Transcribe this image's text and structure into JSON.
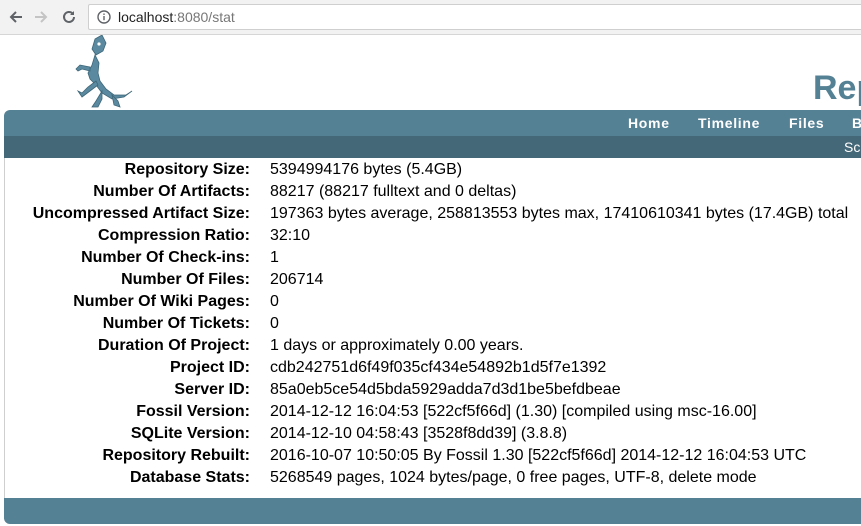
{
  "browser": {
    "url_host": "localhost",
    "url_rest": ":8080/stat"
  },
  "header": {
    "title": "Rep"
  },
  "mainmenu": {
    "items": [
      "Home",
      "Timeline",
      "Files",
      "B"
    ]
  },
  "submenu": {
    "items": [
      "Sc"
    ]
  },
  "stats": [
    {
      "label": "Repository Size:",
      "value": "5394994176 bytes (5.4GB)"
    },
    {
      "label": "Number Of Artifacts:",
      "value": "88217 (88217 fulltext and 0 deltas)"
    },
    {
      "label": "Uncompressed Artifact Size:",
      "value": "197363 bytes average, 258813553 bytes max, 17410610341 bytes (17.4GB) total"
    },
    {
      "label": "Compression Ratio:",
      "value": "32:10"
    },
    {
      "label": "Number Of Check-ins:",
      "value": "1"
    },
    {
      "label": "Number Of Files:",
      "value": "206714"
    },
    {
      "label": "Number Of Wiki Pages:",
      "value": "0"
    },
    {
      "label": "Number Of Tickets:",
      "value": "0"
    },
    {
      "label": "Duration Of Project:",
      "value": "1 days or approximately 0.00 years."
    },
    {
      "label": "Project ID:",
      "value": "cdb242751d6f49f035cf434e54892b1d5f7e1392"
    },
    {
      "label": "Server ID:",
      "value": "85a0eb5ce54d5bda5929adda7d3d1be5befdbeae"
    },
    {
      "label": "Fossil Version:",
      "value": "2014-12-12 16:04:53 [522cf5f66d] (1.30) [compiled using msc-16.00]"
    },
    {
      "label": "SQLite Version:",
      "value": "2014-12-10 04:58:43 [3528f8dd39] (3.8.8)"
    },
    {
      "label": "Repository Rebuilt:",
      "value": "2016-10-07 10:50:05 By Fossil 1.30 [522cf5f66d] 2014-12-12 16:04:53 UTC"
    },
    {
      "label": "Database Stats:",
      "value": "5268549 pages, 1024 bytes/page, 0 free pages, UTF-8, delete mode"
    }
  ],
  "colors": {
    "accent": "#558195",
    "submenu": "#456878"
  }
}
